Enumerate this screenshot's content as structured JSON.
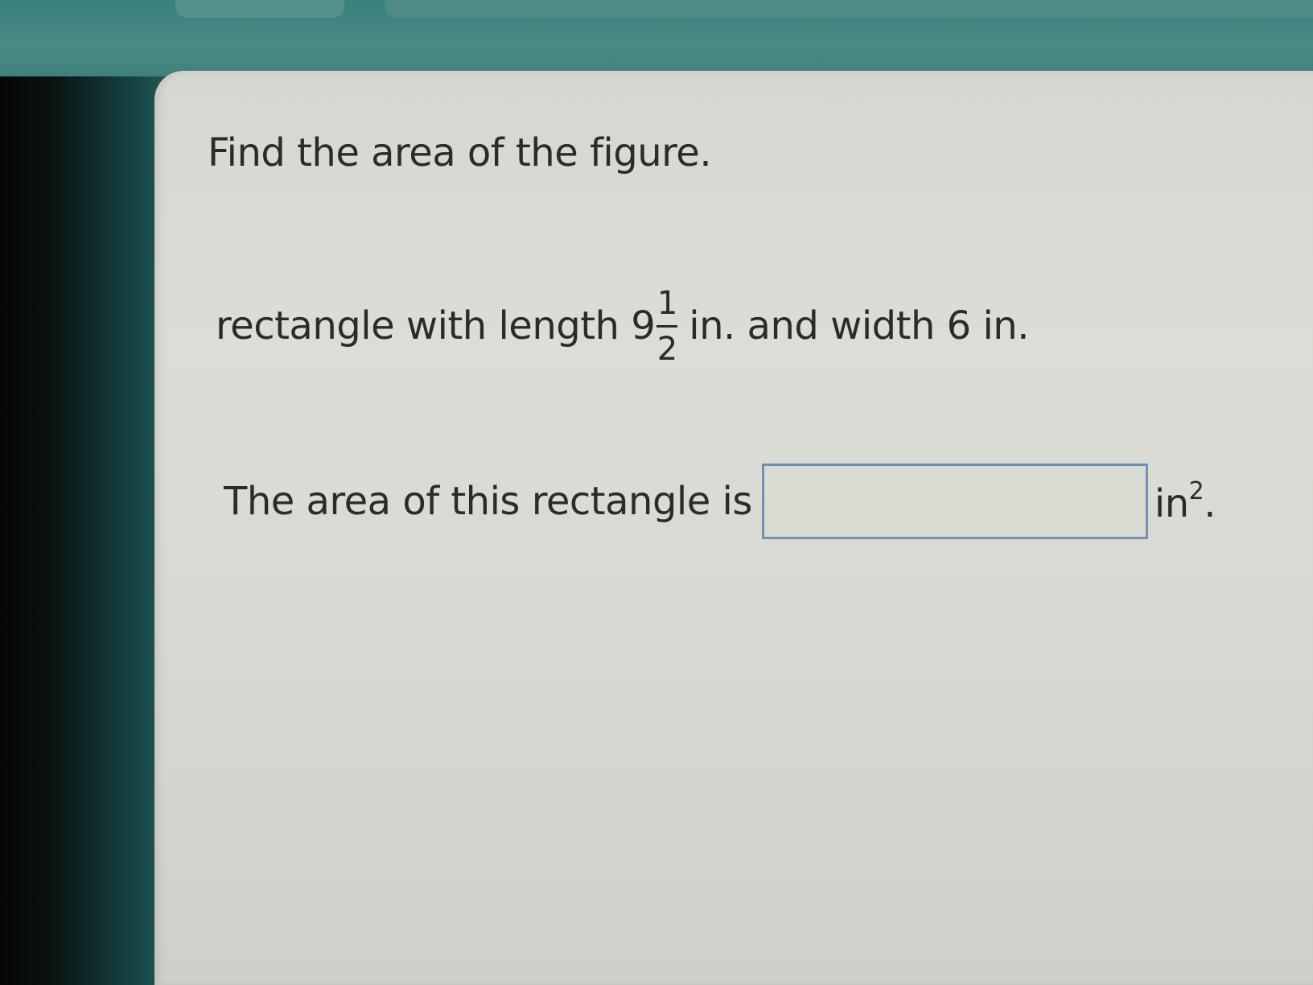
{
  "question": {
    "heading": "Find the area of the figure.",
    "problem_prefix": "rectangle with length 9",
    "fraction_numerator": "1",
    "fraction_denominator": "2",
    "problem_suffix": "in. and width 6 in."
  },
  "answer": {
    "label": "The area of this rectangle is",
    "value": "",
    "unit": "in",
    "unit_exponent": "2",
    "unit_suffix": "."
  }
}
